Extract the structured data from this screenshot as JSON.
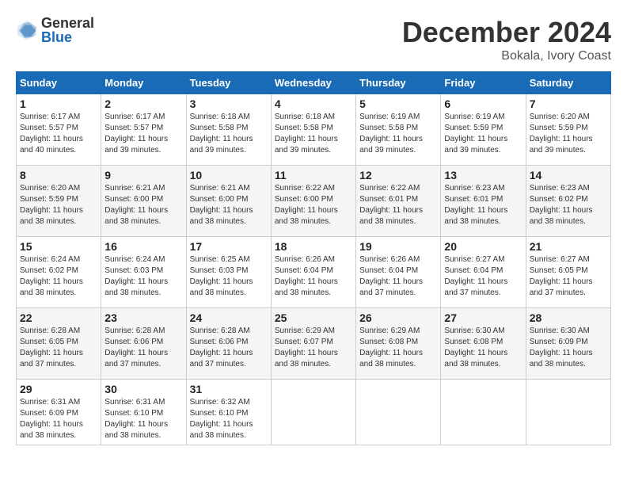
{
  "logo": {
    "general": "General",
    "blue": "Blue"
  },
  "header": {
    "month": "December 2024",
    "location": "Bokala, Ivory Coast"
  },
  "weekdays": [
    "Sunday",
    "Monday",
    "Tuesday",
    "Wednesday",
    "Thursday",
    "Friday",
    "Saturday"
  ],
  "weeks": [
    [
      {
        "day": "1",
        "sunrise": "6:17 AM",
        "sunset": "5:57 PM",
        "daylight": "11 hours and 40 minutes."
      },
      {
        "day": "2",
        "sunrise": "6:17 AM",
        "sunset": "5:57 PM",
        "daylight": "11 hours and 39 minutes."
      },
      {
        "day": "3",
        "sunrise": "6:18 AM",
        "sunset": "5:58 PM",
        "daylight": "11 hours and 39 minutes."
      },
      {
        "day": "4",
        "sunrise": "6:18 AM",
        "sunset": "5:58 PM",
        "daylight": "11 hours and 39 minutes."
      },
      {
        "day": "5",
        "sunrise": "6:19 AM",
        "sunset": "5:58 PM",
        "daylight": "11 hours and 39 minutes."
      },
      {
        "day": "6",
        "sunrise": "6:19 AM",
        "sunset": "5:59 PM",
        "daylight": "11 hours and 39 minutes."
      },
      {
        "day": "7",
        "sunrise": "6:20 AM",
        "sunset": "5:59 PM",
        "daylight": "11 hours and 39 minutes."
      }
    ],
    [
      {
        "day": "8",
        "sunrise": "6:20 AM",
        "sunset": "5:59 PM",
        "daylight": "11 hours and 38 minutes."
      },
      {
        "day": "9",
        "sunrise": "6:21 AM",
        "sunset": "6:00 PM",
        "daylight": "11 hours and 38 minutes."
      },
      {
        "day": "10",
        "sunrise": "6:21 AM",
        "sunset": "6:00 PM",
        "daylight": "11 hours and 38 minutes."
      },
      {
        "day": "11",
        "sunrise": "6:22 AM",
        "sunset": "6:00 PM",
        "daylight": "11 hours and 38 minutes."
      },
      {
        "day": "12",
        "sunrise": "6:22 AM",
        "sunset": "6:01 PM",
        "daylight": "11 hours and 38 minutes."
      },
      {
        "day": "13",
        "sunrise": "6:23 AM",
        "sunset": "6:01 PM",
        "daylight": "11 hours and 38 minutes."
      },
      {
        "day": "14",
        "sunrise": "6:23 AM",
        "sunset": "6:02 PM",
        "daylight": "11 hours and 38 minutes."
      }
    ],
    [
      {
        "day": "15",
        "sunrise": "6:24 AM",
        "sunset": "6:02 PM",
        "daylight": "11 hours and 38 minutes."
      },
      {
        "day": "16",
        "sunrise": "6:24 AM",
        "sunset": "6:03 PM",
        "daylight": "11 hours and 38 minutes."
      },
      {
        "day": "17",
        "sunrise": "6:25 AM",
        "sunset": "6:03 PM",
        "daylight": "11 hours and 38 minutes."
      },
      {
        "day": "18",
        "sunrise": "6:26 AM",
        "sunset": "6:04 PM",
        "daylight": "11 hours and 38 minutes."
      },
      {
        "day": "19",
        "sunrise": "6:26 AM",
        "sunset": "6:04 PM",
        "daylight": "11 hours and 37 minutes."
      },
      {
        "day": "20",
        "sunrise": "6:27 AM",
        "sunset": "6:04 PM",
        "daylight": "11 hours and 37 minutes."
      },
      {
        "day": "21",
        "sunrise": "6:27 AM",
        "sunset": "6:05 PM",
        "daylight": "11 hours and 37 minutes."
      }
    ],
    [
      {
        "day": "22",
        "sunrise": "6:28 AM",
        "sunset": "6:05 PM",
        "daylight": "11 hours and 37 minutes."
      },
      {
        "day": "23",
        "sunrise": "6:28 AM",
        "sunset": "6:06 PM",
        "daylight": "11 hours and 37 minutes."
      },
      {
        "day": "24",
        "sunrise": "6:28 AM",
        "sunset": "6:06 PM",
        "daylight": "11 hours and 37 minutes."
      },
      {
        "day": "25",
        "sunrise": "6:29 AM",
        "sunset": "6:07 PM",
        "daylight": "11 hours and 38 minutes."
      },
      {
        "day": "26",
        "sunrise": "6:29 AM",
        "sunset": "6:08 PM",
        "daylight": "11 hours and 38 minutes."
      },
      {
        "day": "27",
        "sunrise": "6:30 AM",
        "sunset": "6:08 PM",
        "daylight": "11 hours and 38 minutes."
      },
      {
        "day": "28",
        "sunrise": "6:30 AM",
        "sunset": "6:09 PM",
        "daylight": "11 hours and 38 minutes."
      }
    ],
    [
      {
        "day": "29",
        "sunrise": "6:31 AM",
        "sunset": "6:09 PM",
        "daylight": "11 hours and 38 minutes."
      },
      {
        "day": "30",
        "sunrise": "6:31 AM",
        "sunset": "6:10 PM",
        "daylight": "11 hours and 38 minutes."
      },
      {
        "day": "31",
        "sunrise": "6:32 AM",
        "sunset": "6:10 PM",
        "daylight": "11 hours and 38 minutes."
      },
      null,
      null,
      null,
      null
    ]
  ]
}
